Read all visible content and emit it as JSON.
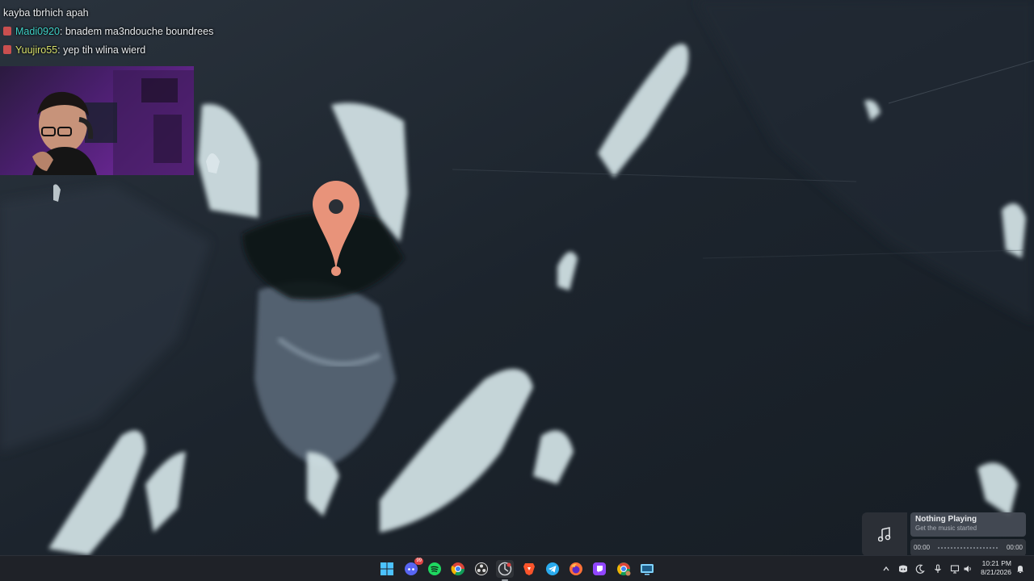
{
  "chat": {
    "messages": [
      {
        "user": "",
        "text": "kayba tbrhich apah"
      },
      {
        "user": "Madi0920",
        "text": ": bnadem ma3ndouche boundrees"
      },
      {
        "user": "Yuujiro55",
        "text": ": yep tih wlina wierd"
      }
    ]
  },
  "map": {
    "pin_icon": "location-pin-icon",
    "pin_color": "#e8937a"
  },
  "music_widget": {
    "title": "Nothing Playing",
    "subtitle": "Get the music started",
    "time_elapsed": "00:00",
    "time_total": "00:00",
    "icon": "music-note-icon"
  },
  "taskbar": {
    "apps": [
      {
        "name": "start-icon"
      },
      {
        "name": "discord-icon",
        "badge": "99"
      },
      {
        "name": "spotify-icon"
      },
      {
        "name": "chrome-icon"
      },
      {
        "name": "obs-icon"
      },
      {
        "name": "app-icon"
      },
      {
        "name": "brave-icon"
      },
      {
        "name": "telegram-icon"
      },
      {
        "name": "firefox-icon"
      },
      {
        "name": "twitch-icon"
      },
      {
        "name": "chrome-profile-icon"
      },
      {
        "name": "remote-desktop-icon"
      }
    ],
    "tray": [
      "chevron-up-icon",
      "discord-tray-icon",
      "moon-icon",
      "microphone-icon",
      "network-icon",
      "volume-icon"
    ],
    "clock_time": "10:21 PM",
    "clock_date": "8/21/2026"
  }
}
